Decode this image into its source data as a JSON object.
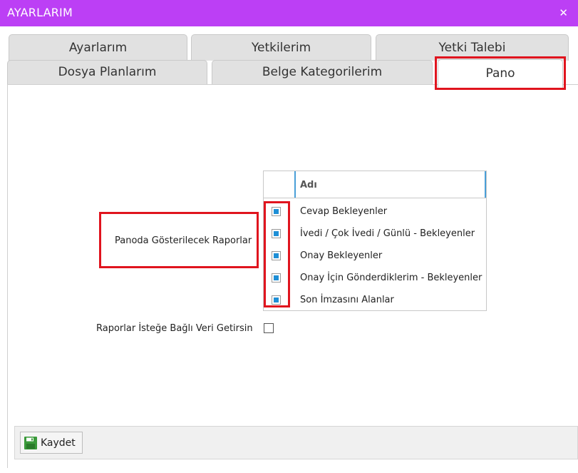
{
  "window": {
    "title": "AYARLARIM",
    "close_glyph": "✕"
  },
  "tabs_row1": [
    {
      "label": "Ayarlarım"
    },
    {
      "label": "Yetkilerim"
    },
    {
      "label": "Yetki Talebi"
    }
  ],
  "tabs_row2": [
    {
      "label": "Dosya Planlarım"
    },
    {
      "label": "Belge Kategorilerim"
    },
    {
      "label": "Pano",
      "active": true
    }
  ],
  "pano": {
    "reports_label": "Panoda Gösterilecek Raporlar",
    "grid_header": "Adı",
    "reports": [
      {
        "name": "Cevap Bekleyenler",
        "checked": true
      },
      {
        "name": "İvedi / Çok İvedi / Günlü - Bekleyenler",
        "checked": true
      },
      {
        "name": "Onay Bekleyenler",
        "checked": true
      },
      {
        "name": "Onay İçin Gönderdiklerim - Bekleyenler",
        "checked": true
      },
      {
        "name": "Son İmzasını Alanlar",
        "checked": true
      }
    ],
    "optional_label": "Raporlar İsteğe Bağlı Veri Getirsin",
    "optional_checked": false
  },
  "toolbar": {
    "save_label": "Kaydet",
    "save_icon": "floppy-disk-icon"
  },
  "colors": {
    "titlebar": "#bc3ff5",
    "highlight": "#e0141e",
    "check_fill": "#1e8fd6",
    "save_icon": "#3a9a3a"
  }
}
